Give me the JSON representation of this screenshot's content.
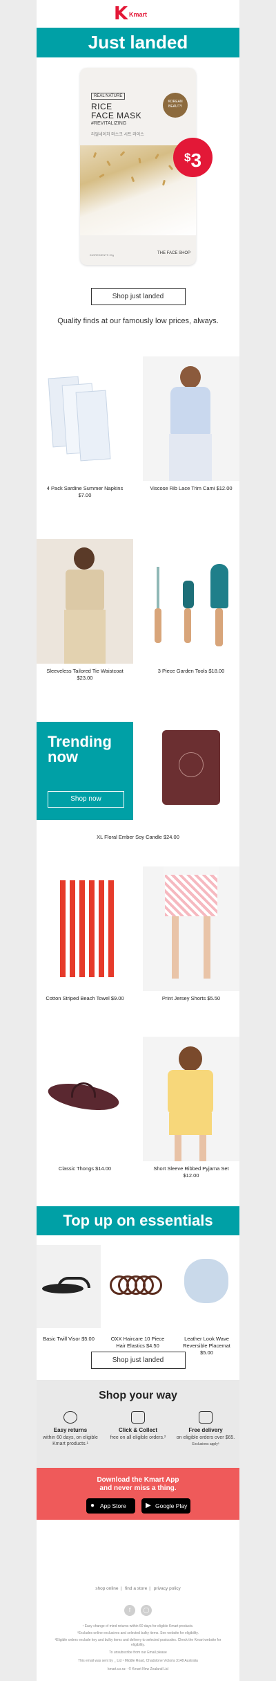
{
  "brand": {
    "logo_text": "Kmart"
  },
  "hero": {
    "banner": "Just landed",
    "product": {
      "tag": "REAL NATURE",
      "title_line1": "RICE",
      "title_line2": "FACE MASK",
      "subtitle": "#REVITALIZING",
      "korean": "리얼네이처 마스크 시트 라이스",
      "seal": "KOREAN BEAUTY",
      "brand": "THE FACE SHOP",
      "fine_print": "INGREDIENTS 20g"
    },
    "price_currency": "$",
    "price": "3",
    "cta": "Shop just landed",
    "tagline": "Quality finds at our famously low prices, always."
  },
  "products": [
    {
      "name": "4 Pack Sardine Summer Napkins",
      "price": "$7.00"
    },
    {
      "name": "Viscose Rib Lace Trim Cami",
      "price": "$12.00"
    },
    {
      "name": "Sleeveless Tailored Tie Waistcoat",
      "price": "$23.00"
    },
    {
      "name": "3 Piece Garden Tools",
      "price": "$18.00"
    }
  ],
  "trending": {
    "title_line1": "Trending",
    "title_line2": "now",
    "cta": "Shop now",
    "product": {
      "name": "XL Floral Ember Soy Candle",
      "price": "$24.00"
    }
  },
  "products_more": [
    {
      "name": "Cotton Striped Beach Towel",
      "price": "$9.00"
    },
    {
      "name": "Print Jersey Shorts",
      "price": "$5.50"
    },
    {
      "name": "Classic Thongs",
      "price": "$14.00"
    },
    {
      "name": "Short Sleeve Ribbed Pyjama Set",
      "price": "$12.00"
    }
  ],
  "essentials": {
    "banner": "Top up on essentials",
    "items": [
      {
        "name": "Basic Twill Visor",
        "price": "$5.00"
      },
      {
        "name": "OXX Haircare 10 Piece Hair Elastics",
        "price": "$4.50"
      },
      {
        "name": "Leather Look Wave Reversible Placemat",
        "price": "$5.00"
      }
    ],
    "cta": "Shop just landed"
  },
  "shop_your_way": {
    "title": "Shop your way",
    "columns": [
      {
        "icon": "returns-icon",
        "head": "Easy returns",
        "text": "within 60 days, on eligible Kmart products.¹"
      },
      {
        "icon": "click-collect-icon",
        "head": "Click & Collect",
        "text": "free on all eligible orders.²"
      },
      {
        "icon": "delivery-truck-icon",
        "head": "Free delivery",
        "text": "on eligible orders over $65.",
        "note": "Exclusions apply³"
      }
    ]
  },
  "app": {
    "title_line1": "Download the Kmart App",
    "title_line2": "and never miss a thing.",
    "app_store_label": "App Store",
    "google_play_label": "Google Play"
  },
  "footer": {
    "links": [
      "shop online",
      "find a store",
      "privacy policy"
    ],
    "social": [
      "facebook-icon",
      "instagram-icon"
    ],
    "legal": [
      "¹ Easy change of mind returns within 60 days for eligible Kmart products.",
      "²Excludes online exclusives and selected bulky items. See website for eligibility.",
      "³Eligible orders exclude key and bulky items and delivery to selected postcodes. Check the Kmart website for eligibility.",
      "To unsubscribe from our Email please",
      "This email was sent by _ Ltd ¹ Middle Road, Chadstone Victoria 3148 Australia",
      "kmart.co.nz · © Kmart New Zealand Ltd"
    ]
  },
  "colors": {
    "teal": "#00a0a6",
    "red": "#e31837",
    "coral": "#ef5a5a"
  }
}
